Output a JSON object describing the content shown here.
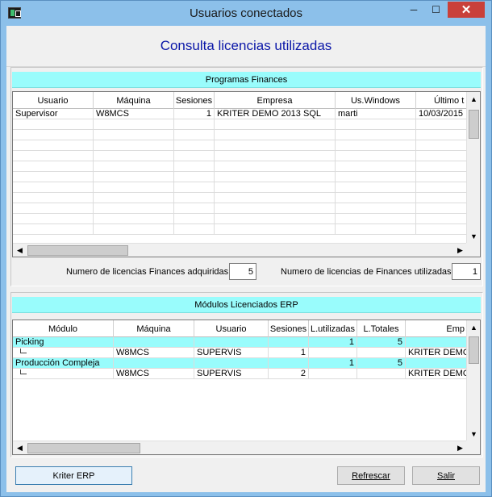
{
  "window": {
    "title": "Usuarios conectados",
    "controls": {
      "minimize": "─",
      "maximize": "☐",
      "close": "✕"
    }
  },
  "header": {
    "title": "Consulta licencias utilizadas"
  },
  "finances": {
    "section_title": "Programas Finances",
    "columns": [
      "Usuario",
      "Máquina",
      "Sesiones",
      "Empresa",
      "Us.Windows",
      "Último t"
    ],
    "rows": [
      {
        "usuario": "Supervisor",
        "maquina": "W8MCS",
        "sesiones": "1",
        "empresa": "KRITER DEMO 2013 SQL",
        "uswindows": "marti",
        "ultimo": "10/03/2015"
      }
    ],
    "adquiridas_label": "Numero de licencias Finances adquiridas",
    "adquiridas_value": "5",
    "utilizadas_label": "Numero de licencias de Finances utilizadas",
    "utilizadas_value": "1"
  },
  "erp": {
    "section_title": "Módulos Licenciados ERP",
    "columns": [
      "Módulo",
      "Máquina",
      "Usuario",
      "Sesiones",
      "L.utilizadas",
      "L.Totales",
      "Emp"
    ],
    "rows": [
      {
        "modulo": "Picking",
        "maquina": "",
        "usuario": "",
        "sesiones": "",
        "lutilizadas": "1",
        "ltotales": "5",
        "empresa": "",
        "highlight": true
      },
      {
        "modulo": "",
        "maquina": "W8MCS",
        "usuario": "SUPERVIS",
        "sesiones": "1",
        "lutilizadas": "",
        "ltotales": "",
        "empresa": "KRITER DEMO",
        "child": true
      },
      {
        "modulo": "Producción Compleja",
        "maquina": "",
        "usuario": "",
        "sesiones": "",
        "lutilizadas": "1",
        "ltotales": "5",
        "empresa": "",
        "highlight": true
      },
      {
        "modulo": "",
        "maquina": "W8MCS",
        "usuario": "SUPERVIS",
        "sesiones": "2",
        "lutilizadas": "",
        "ltotales": "",
        "empresa": "KRITER DEMO",
        "child": true
      }
    ]
  },
  "footer": {
    "kriter_erp": "Kriter ERP",
    "refrescar": "Refrescar",
    "salir": "Salir"
  },
  "scroll": {
    "left": "◀",
    "right": "▶",
    "up": "▲",
    "down": "▼"
  },
  "colors": {
    "section_band": "#99fcfc",
    "title_blue": "#0b17a8"
  }
}
